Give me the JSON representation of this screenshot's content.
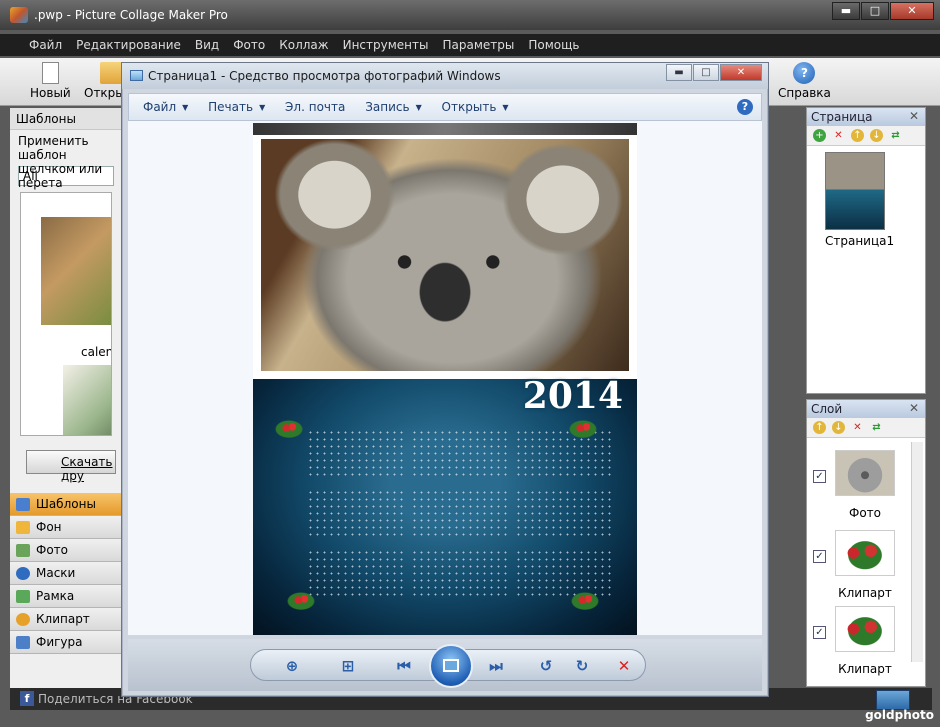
{
  "app": {
    "title": ".pwp - Picture Collage Maker Pro",
    "window_controls": {
      "minimize": "▬",
      "maximize": "□",
      "close": "✕"
    },
    "menu": [
      "Файл",
      "Редактирование",
      "Вид",
      "Фото",
      "Коллаж",
      "Инструменты",
      "Параметры",
      "Помощь"
    ],
    "toolbar": {
      "new": "Новый",
      "open": "Открыть",
      "help": "Справка"
    }
  },
  "left_panel": {
    "header": "Шаблоны",
    "description": "Применить шаблон щелчком или перета",
    "filter_value": "All",
    "templates": [
      {
        "label": "calenda"
      }
    ],
    "download_button": "Скачать дру",
    "nav": [
      {
        "label": "Шаблоны",
        "color": "#4a7fd0"
      },
      {
        "label": "Фон",
        "color": "#f0b63c"
      },
      {
        "label": "Фото",
        "color": "#6aa35a"
      },
      {
        "label": "Маски",
        "color": "#2f6cc0"
      },
      {
        "label": "Рамка",
        "color": "#5aa85a"
      },
      {
        "label": "Клипарт",
        "color": "#e6a12b"
      },
      {
        "label": "Фигура",
        "color": "#4d7fc8"
      }
    ]
  },
  "status_bar": {
    "share": "Поделиться на Facebook"
  },
  "page_panel": {
    "title": "Страница",
    "page_label": "Страница1"
  },
  "layer_panel": {
    "title": "Слой",
    "layers": [
      {
        "label": "Фото",
        "checked": "✓"
      },
      {
        "label": "Клипарт",
        "checked": "✓"
      },
      {
        "label": "Клипарт",
        "checked": "✓"
      }
    ]
  },
  "viewer": {
    "title": "Страница1 - Средство просмотра фотографий Windows",
    "menu": [
      "Файл",
      "Печать",
      "Эл. почта",
      "Запись",
      "Открыть"
    ],
    "help": "?",
    "calendar_year": "2014"
  },
  "watermark": "goldphoto"
}
